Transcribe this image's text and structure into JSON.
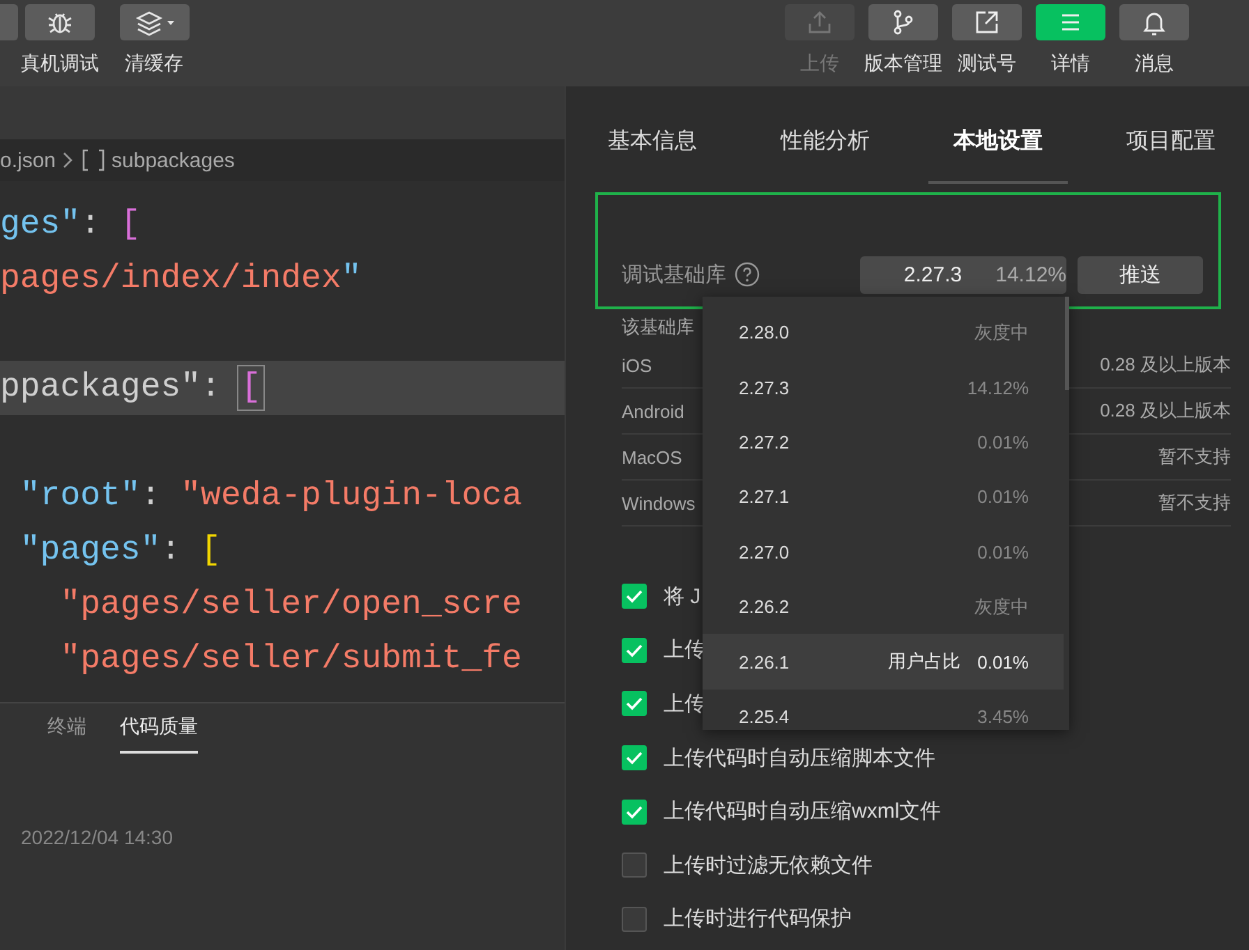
{
  "toolbar": {
    "left": [
      {
        "kind": "blank"
      },
      {
        "kind": "bug",
        "label": "真机调试"
      },
      {
        "kind": "layers",
        "label": "清缓存"
      }
    ],
    "right": [
      {
        "kind": "upload",
        "label": "上传",
        "disabled": true,
        "selected": false
      },
      {
        "kind": "branch",
        "label": "版本管理",
        "disabled": false,
        "selected": false
      },
      {
        "kind": "external",
        "label": "测试号",
        "disabled": false,
        "selected": false
      },
      {
        "kind": "menu",
        "label": "详情",
        "disabled": false,
        "selected": true
      },
      {
        "kind": "bell",
        "label": "消息",
        "disabled": false,
        "selected": false
      }
    ]
  },
  "editor": {
    "breadcrumb": {
      "file": "o.json",
      "symbol": "subpackages"
    },
    "lines": [
      {
        "kind": "code",
        "current": false,
        "tokens": [
          {
            "kind": "key",
            "text": "ges\""
          },
          {
            "kind": "punct",
            "text": ": "
          },
          {
            "kind": "bracket1",
            "text": "["
          }
        ]
      },
      {
        "kind": "code",
        "current": false,
        "tokens": [
          {
            "kind": "string",
            "text": "pages/index/index"
          },
          {
            "kind": "key",
            "text": "\""
          }
        ]
      },
      {
        "kind": "blank"
      },
      {
        "kind": "code",
        "current": true,
        "tokens": [
          {
            "kind": "plain",
            "text": "ppackages\": "
          },
          {
            "kind": "bracket1",
            "text": "[",
            "boxed": true
          }
        ]
      },
      {
        "kind": "blank"
      },
      {
        "kind": "code",
        "current": false,
        "tokens": [
          {
            "kind": "key",
            "text": " \"root\""
          },
          {
            "kind": "punct",
            "text": ": "
          },
          {
            "kind": "string",
            "text": "\"weda-plugin-loca"
          }
        ]
      },
      {
        "kind": "code",
        "current": false,
        "tokens": [
          {
            "kind": "key",
            "text": " \"pages\""
          },
          {
            "kind": "punct",
            "text": ": "
          },
          {
            "kind": "bracket2",
            "text": "["
          }
        ]
      },
      {
        "kind": "code",
        "current": false,
        "tokens": [
          {
            "kind": "string",
            "text": "   \"pages/seller/open_scre"
          }
        ]
      },
      {
        "kind": "code",
        "current": false,
        "tokens": [
          {
            "kind": "string",
            "text": "   \"pages/seller/submit_fe"
          }
        ]
      }
    ]
  },
  "bottom_panel": {
    "tabs": [
      {
        "label": "终端",
        "selected": false
      },
      {
        "label": "代码质量",
        "selected": true
      }
    ],
    "entry": {
      "time": "2022/12/04 14:30"
    }
  },
  "settings": {
    "tabs": [
      {
        "label": "基本信息",
        "selected": false
      },
      {
        "label": "性能分析",
        "selected": false
      },
      {
        "label": "本地设置",
        "selected": true
      },
      {
        "label": "项目配置",
        "selected": false
      }
    ],
    "base_library": {
      "label": "调试基础库",
      "version": "2.27.3",
      "share": "14.12%",
      "push_button": "推送"
    },
    "support_caption": "该基础库",
    "support": [
      {
        "platform": "iOS",
        "value": "0.28 及以上版本"
      },
      {
        "platform": "Android",
        "value": "0.28 及以上版本"
      },
      {
        "platform": "MacOS",
        "value": "暂不支持"
      },
      {
        "platform": "Windows",
        "value": "暂不支持"
      }
    ],
    "options": [
      {
        "label": "将 J",
        "checked": true
      },
      {
        "label": "上传",
        "checked": true
      },
      {
        "label": "上传",
        "checked": true
      },
      {
        "label": "上传代码时自动压缩脚本文件",
        "checked": true
      },
      {
        "label": "上传代码时自动压缩wxml文件",
        "checked": true
      },
      {
        "label": "上传时过滤无依赖文件",
        "checked": false
      },
      {
        "label": "上传时进行代码保护",
        "checked": false
      }
    ]
  },
  "version_dropdown": {
    "options": [
      {
        "version": "2.28.0",
        "note": "灰度中",
        "hovered": false
      },
      {
        "version": "2.27.3",
        "note": "14.12%",
        "hovered": false
      },
      {
        "version": "2.27.2",
        "note": "0.01%",
        "hovered": false
      },
      {
        "version": "2.27.1",
        "note": "0.01%",
        "hovered": false
      },
      {
        "version": "2.27.0",
        "note": "0.01%",
        "hovered": false
      },
      {
        "version": "2.26.2",
        "note": "灰度中",
        "hovered": false
      },
      {
        "version": "2.26.1",
        "note": "0.01%",
        "hint": "用户占比",
        "hovered": true
      },
      {
        "version": "2.25.4",
        "note": "3.45%",
        "hovered": false
      }
    ]
  }
}
